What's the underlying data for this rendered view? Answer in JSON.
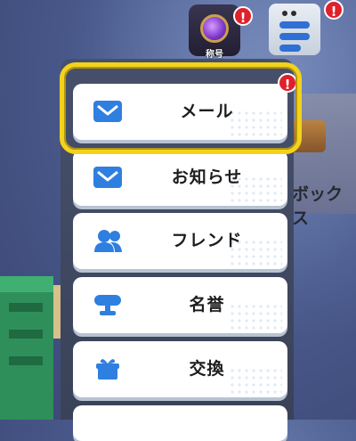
{
  "hud": {
    "medal_caption": "称号",
    "medal_badge": "!",
    "settings_badge": "!",
    "box_label": "ボックス"
  },
  "menu": {
    "items": [
      {
        "id": "mail",
        "label": "メール",
        "icon": "mail-icon",
        "badge": "!"
      },
      {
        "id": "news",
        "label": "お知らせ",
        "icon": "mail-icon"
      },
      {
        "id": "friend",
        "label": "フレンド",
        "icon": "friends-icon"
      },
      {
        "id": "honor",
        "label": "名誉",
        "icon": "trophy-icon"
      },
      {
        "id": "exchange",
        "label": "交換",
        "icon": "gift-icon"
      }
    ]
  },
  "colors": {
    "accent_blue": "#2f7fe0",
    "highlight_yellow": "#f3d21c",
    "badge_red": "#e0202a"
  }
}
